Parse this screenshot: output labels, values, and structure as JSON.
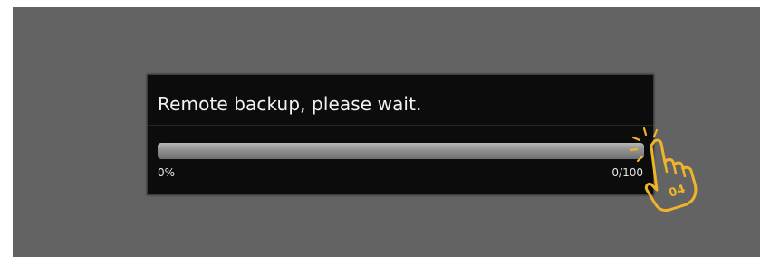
{
  "dialog": {
    "title": "Remote backup, please wait.",
    "progress": {
      "percent_label": "0%",
      "count_label": "0/100",
      "value": 0,
      "max": 100
    }
  },
  "annotation": {
    "step_number": "04",
    "icon": "pointing-hand-icon",
    "color": "#f0b429"
  },
  "colors": {
    "background": "#636363",
    "dialog": "#0c0c0c",
    "text": "#f2f2f2"
  }
}
